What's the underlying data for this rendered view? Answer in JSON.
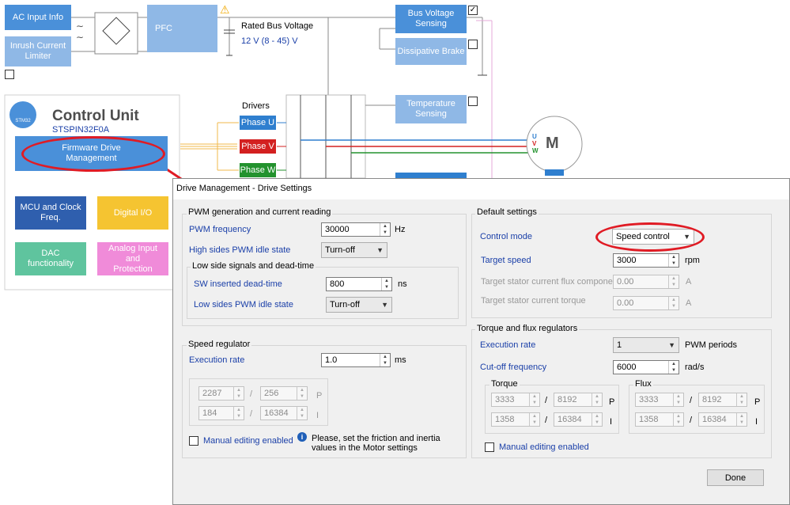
{
  "diagram": {
    "ac_input": "AC Input Info",
    "inrush": "Inrush Current Limiter",
    "pfc": "PFC",
    "rated_bus_voltage_label": "Rated Bus Voltage",
    "rated_bus_voltage_value": "12 V (8 - 45) V",
    "bus_voltage_sensing": "Bus Voltage Sensing",
    "dissipative_brake": "Dissipative Brake",
    "temperature_sensing": "Temperature Sensing",
    "control_unit_title": "Control Unit",
    "control_unit_part": "STSPIN32F0A",
    "logo_text": "STM32",
    "firmware": "Firmware Drive Management",
    "mcu": "MCU and Clock Freq.",
    "digital_io": "Digital I/O",
    "dac": "DAC functionality",
    "analog": "Analog Input and Protection",
    "drivers": "Drivers",
    "phase_u": "Phase U",
    "phase_v": "Phase V",
    "phase_w": "Phase W",
    "motor": "M",
    "motor_u": "U",
    "motor_v": "V",
    "motor_w": "W",
    "checkmark": "✓"
  },
  "dialog": {
    "title": "Drive Management - Drive Settings",
    "pwm": {
      "group": "PWM generation and current reading",
      "freq_label": "PWM frequency",
      "freq_value": "30000",
      "freq_unit": "Hz",
      "high_label": "High sides PWM idle state",
      "high_value": "Turn-off",
      "low_group": "Low side signals and dead-time",
      "dead_label": "SW inserted dead-time",
      "dead_value": "800",
      "dead_unit": "ns",
      "low_label": "Low sides PWM idle state",
      "low_value": "Turn-off"
    },
    "speed": {
      "group": "Speed regulator",
      "exec_label": "Execution rate",
      "exec_value": "1.0",
      "exec_unit": "ms",
      "kp_num": "2287",
      "kp_den": "256",
      "ki_num": "184",
      "ki_den": "16384",
      "p": "P",
      "i": "I",
      "slash": "/",
      "manual": "Manual editing enabled",
      "info": "Please, set the friction and inertia values in the Motor settings"
    },
    "defaults": {
      "group": "Default settings",
      "mode_label": "Control mode",
      "mode_value": "Speed control",
      "target_speed_label": "Target speed",
      "target_speed_value": "3000",
      "target_speed_unit": "rpm",
      "flux_label": "Target stator current flux component",
      "flux_value": "0.00",
      "flux_unit": "A",
      "torque_label": "Target stator current torque",
      "torque_value": "0.00",
      "torque_unit": "A"
    },
    "tf": {
      "group": "Torque and flux regulators",
      "exec_label": "Execution rate",
      "exec_value": "1",
      "exec_unit": "PWM periods",
      "cutoff_label": "Cut-off frequency",
      "cutoff_value": "6000",
      "cutoff_unit": "rad/s",
      "torque_group": "Torque",
      "flux_group": "Flux",
      "t_kp_num": "3333",
      "t_kp_den": "8192",
      "t_ki_num": "1358",
      "t_ki_den": "16384",
      "f_kp_num": "3333",
      "f_kp_den": "8192",
      "f_ki_num": "1358",
      "f_ki_den": "16384",
      "p": "P",
      "i": "I",
      "slash": "/",
      "manual": "Manual editing enabled"
    },
    "done": "Done"
  }
}
